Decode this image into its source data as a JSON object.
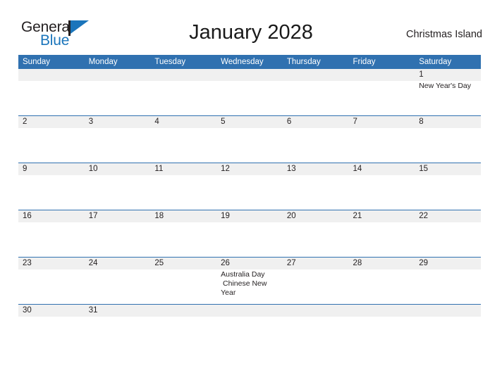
{
  "header": {
    "logo": {
      "word_one": "General",
      "word_two": "Blue"
    },
    "title": "January 2028",
    "location": "Christmas Island"
  },
  "calendar": {
    "weekdays": [
      "Sunday",
      "Monday",
      "Tuesday",
      "Wednesday",
      "Thursday",
      "Friday",
      "Saturday"
    ],
    "colors": {
      "header_blue": "#3071b0",
      "date_band_gray": "#f0f0f0",
      "rule_blue": "#3071b0",
      "text": "#231f20",
      "logo_blue": "#1b75bb"
    },
    "weeks": [
      {
        "rule": false,
        "days": [
          {
            "date": "",
            "events": ""
          },
          {
            "date": "",
            "events": ""
          },
          {
            "date": "",
            "events": ""
          },
          {
            "date": "",
            "events": ""
          },
          {
            "date": "",
            "events": ""
          },
          {
            "date": "",
            "events": ""
          },
          {
            "date": "1",
            "events": "New Year's Day"
          }
        ]
      },
      {
        "rule": true,
        "days": [
          {
            "date": "2",
            "events": ""
          },
          {
            "date": "3",
            "events": ""
          },
          {
            "date": "4",
            "events": ""
          },
          {
            "date": "5",
            "events": ""
          },
          {
            "date": "6",
            "events": ""
          },
          {
            "date": "7",
            "events": ""
          },
          {
            "date": "8",
            "events": ""
          }
        ]
      },
      {
        "rule": true,
        "days": [
          {
            "date": "9",
            "events": ""
          },
          {
            "date": "10",
            "events": ""
          },
          {
            "date": "11",
            "events": ""
          },
          {
            "date": "12",
            "events": ""
          },
          {
            "date": "13",
            "events": ""
          },
          {
            "date": "14",
            "events": ""
          },
          {
            "date": "15",
            "events": ""
          }
        ]
      },
      {
        "rule": true,
        "days": [
          {
            "date": "16",
            "events": ""
          },
          {
            "date": "17",
            "events": ""
          },
          {
            "date": "18",
            "events": ""
          },
          {
            "date": "19",
            "events": ""
          },
          {
            "date": "20",
            "events": ""
          },
          {
            "date": "21",
            "events": ""
          },
          {
            "date": "22",
            "events": ""
          }
        ]
      },
      {
        "rule": true,
        "days": [
          {
            "date": "23",
            "events": ""
          },
          {
            "date": "24",
            "events": ""
          },
          {
            "date": "25",
            "events": ""
          },
          {
            "date": "26",
            "events": "Australia Day\n Chinese New Year"
          },
          {
            "date": "27",
            "events": ""
          },
          {
            "date": "28",
            "events": ""
          },
          {
            "date": "29",
            "events": ""
          }
        ]
      },
      {
        "rule": true,
        "last": true,
        "days": [
          {
            "date": "30",
            "events": ""
          },
          {
            "date": "31",
            "events": ""
          },
          {
            "date": "",
            "events": ""
          },
          {
            "date": "",
            "events": ""
          },
          {
            "date": "",
            "events": ""
          },
          {
            "date": "",
            "events": ""
          },
          {
            "date": "",
            "events": ""
          }
        ]
      }
    ]
  }
}
